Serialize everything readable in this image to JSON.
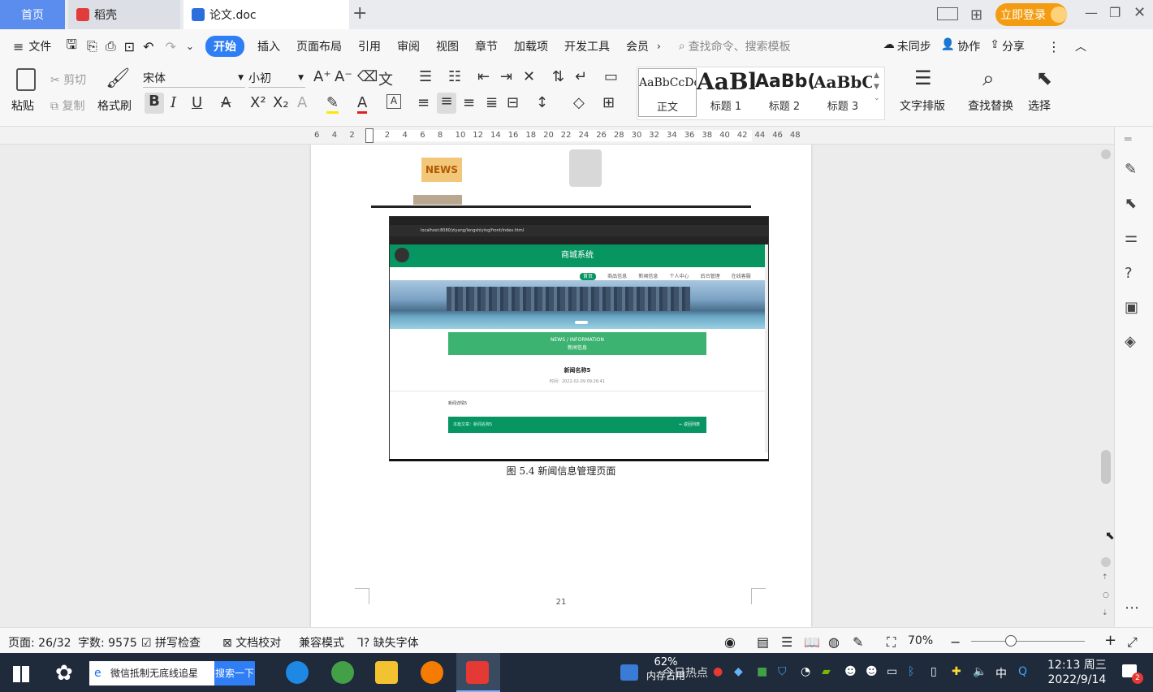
{
  "tabs": {
    "home": "首页",
    "daoke": "稻壳",
    "doc": "论文.doc",
    "new_tab": "+"
  },
  "window": {
    "login": "立即登录"
  },
  "menu": {
    "file": "文件",
    "items": [
      "开始",
      "插入",
      "页面布局",
      "引用",
      "审阅",
      "视图",
      "章节",
      "加载项",
      "开发工具",
      "会员"
    ],
    "search_placeholder": "查找命令、搜索模板",
    "sync": "未同步",
    "collab": "协作",
    "share": "分享"
  },
  "ribbon": {
    "paste": "粘贴",
    "cut": "剪切",
    "copy": "复制",
    "format_painter": "格式刷",
    "font_name": "宋体",
    "font_size": "小初",
    "styles": [
      {
        "preview": "AaBbCcDd",
        "label": "正文"
      },
      {
        "preview": "AaBl",
        "label": "标题 1"
      },
      {
        "preview": "AaBb(",
        "label": "标题 2"
      },
      {
        "preview": "AaBbC",
        "label": "标题 3"
      }
    ],
    "text_layout": "文字排版",
    "find_replace": "查找替换",
    "select": "选择"
  },
  "ruler": {
    "ticks": [
      "6",
      "4",
      "2",
      "",
      "2",
      "4",
      "6",
      "8",
      "10",
      "12",
      "14",
      "16",
      "18",
      "20",
      "22",
      "24",
      "26",
      "28",
      "30",
      "32",
      "34",
      "36",
      "38",
      "40",
      "42",
      "44",
      "46",
      "48"
    ]
  },
  "document": {
    "news_sticker": "NEWS",
    "embedded": {
      "site_title": "商城系统",
      "url": "localhost:8080/ziyang/lengshiying/front/index.html",
      "nav": [
        "首页",
        "商品信息",
        "新闻信息",
        "个人中心",
        "后台管理",
        "在线客服"
      ],
      "news_heading_en": "NEWS / INFORMATION",
      "news_heading_cn": "新闻信息",
      "news_title": "新闻名称5",
      "news_time": "时间：2022-02-09 09:26:41",
      "news_detail": "新闻详情5",
      "bottom_bar": "本篇文章：新闻名称5",
      "back_link": "← 返回列表"
    },
    "caption": "图 5.4  新闻信息管理页面",
    "page_number": "21"
  },
  "status": {
    "page": "页面: 26/32",
    "words": "字数: 9575",
    "spell": "拼写检查",
    "proof": "文档校对",
    "compat": "兼容模式",
    "missing_font": "缺失字体",
    "zoom": "70%"
  },
  "taskbar": {
    "search_text": "微信抵制无底线追星",
    "search_button": "搜索一下",
    "mem_percent": "62%",
    "mem_label": "内存占用",
    "hot": "今日热点",
    "ime": "中",
    "time": "12:13 周三",
    "date": "2022/9/14",
    "notify_count": "2"
  }
}
